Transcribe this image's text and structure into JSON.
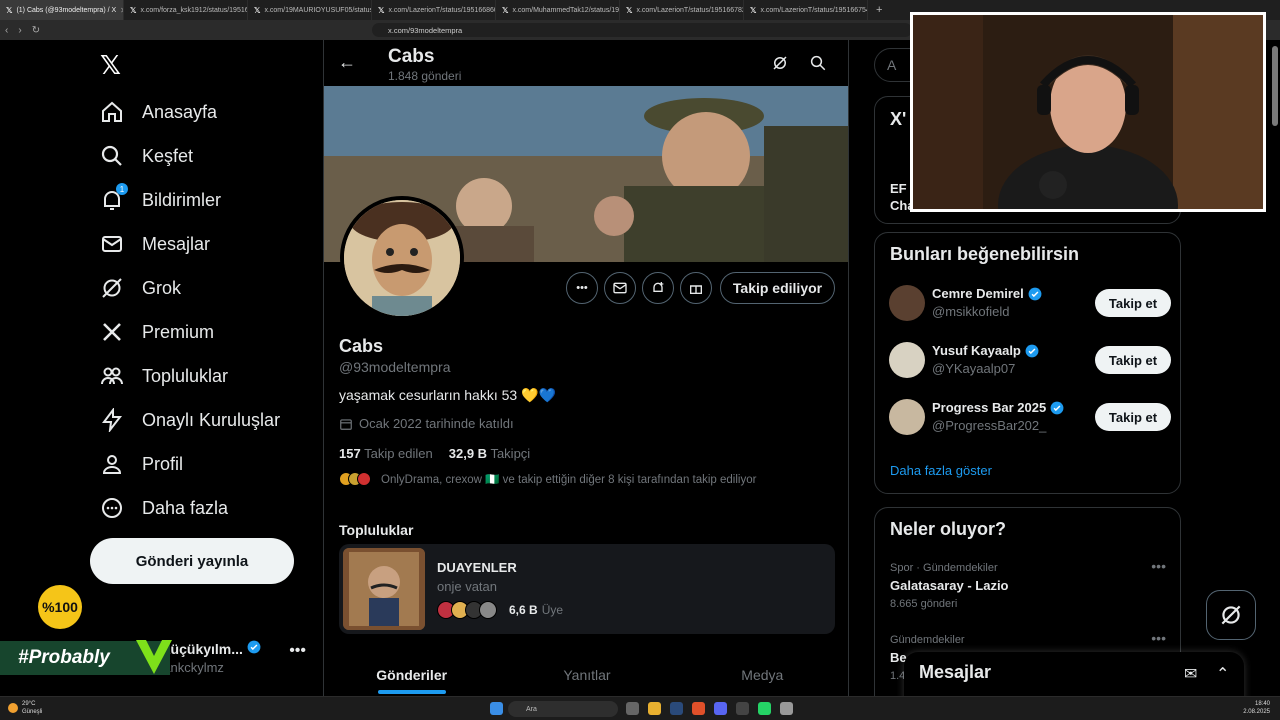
{
  "browser": {
    "tabs": [
      {
        "title": "(1) Cabs (@93modeltempra) / X",
        "active": true
      },
      {
        "title": "x.com/forza_ksk1912/status/19516...",
        "active": false
      },
      {
        "title": "x.com/19MAURIOYUSUF05/status/19...",
        "active": false
      },
      {
        "title": "x.com/LazerionT/status/195166860...",
        "active": false
      },
      {
        "title": "x.com/MuhammedTak12/status/195...",
        "active": false
      },
      {
        "title": "x.com/LazerionT/status/195166782...",
        "active": false
      },
      {
        "title": "x.com/LazerionT/status/195166754...",
        "active": false
      }
    ],
    "url": "x.com/93modeltempra"
  },
  "nav": {
    "items": [
      {
        "label": "Anasayfa",
        "icon": "home-icon"
      },
      {
        "label": "Keşfet",
        "icon": "search-icon"
      },
      {
        "label": "Bildirimler",
        "icon": "bell-icon",
        "badge": "1"
      },
      {
        "label": "Mesajlar",
        "icon": "mail-icon"
      },
      {
        "label": "Grok",
        "icon": "grok-icon"
      },
      {
        "label": "Premium",
        "icon": "x-icon"
      },
      {
        "label": "Topluluklar",
        "icon": "people-icon"
      },
      {
        "label": "Onaylı Kuruluşlar",
        "icon": "lightning-icon"
      },
      {
        "label": "Profil",
        "icon": "person-icon"
      },
      {
        "label": "Daha fazla",
        "icon": "more-circle-icon"
      }
    ],
    "post_button": "Gönderi yayınla",
    "account": {
      "name": "n Küçükyılm...",
      "handle": "aankckylmz"
    }
  },
  "overlays": {
    "badge_100": "%100",
    "probably": "#Probably"
  },
  "profile": {
    "title": "Cabs",
    "post_count": "1.848 gönderi",
    "name": "Cabs",
    "handle": "@93modeltempra",
    "bio": "yaşamak cesurların hakkı 53 💛💙",
    "joined": "Ocak 2022 tarihinde katıldı",
    "following_count": "157",
    "following_label": "Takip edilen",
    "followers_count": "32,9 B",
    "followers_label": "Takipçi",
    "followed_by": "OnlyDrama, crexow 🇳🇬 ve takip ettiğin diğer 8 kişi tarafından takip ediliyor",
    "follow_button": "Takip ediliyor",
    "communities_title": "Topluluklar",
    "community": {
      "name": "DUAYENLER",
      "subtitle": "onje vatan",
      "members_count": "6,6 B",
      "members_label": "Üye"
    },
    "tabs": [
      "Gönderiler",
      "Yanıtlar",
      "Medya"
    ]
  },
  "sidebar": {
    "search_placeholder": "A",
    "suggestions_title": "Bunları beğenebilirsin",
    "suggestions": [
      {
        "name": "Cemre Demirel",
        "handle": "@msikkofield",
        "button": "Takip et",
        "color": "#5a4030"
      },
      {
        "name": "Yusuf Kayaalp",
        "handle": "@YKayaalp07",
        "button": "Takip et",
        "color": "#d8d2c2"
      },
      {
        "name": "Progress Bar 2025",
        "handle": "@ProgressBar202_",
        "button": "Takip et",
        "color": "#c8b8a0"
      }
    ],
    "show_more": "Daha fazla göster",
    "trends_title": "Neler oluyor?",
    "trends": [
      {
        "category": "Spor · Gündemdekiler",
        "title": "Galatasaray - Lazio",
        "count": "8.665 gönderi"
      },
      {
        "category": "Gündemdekiler",
        "title": "Be",
        "count": "1.4"
      }
    ],
    "partial_box": {
      "title": "X'",
      "line1": "EF",
      "line2": "Cha"
    },
    "messages_drawer": "Mesajlar"
  },
  "taskbar": {
    "temp": "29°C",
    "weather": "Güneşli",
    "search": "Ara",
    "time": "18:40",
    "date": "2.08.2025"
  },
  "colors": {
    "accent": "#1d9bf0",
    "background": "#000000",
    "border": "#2f3336",
    "muted": "#71767b"
  }
}
